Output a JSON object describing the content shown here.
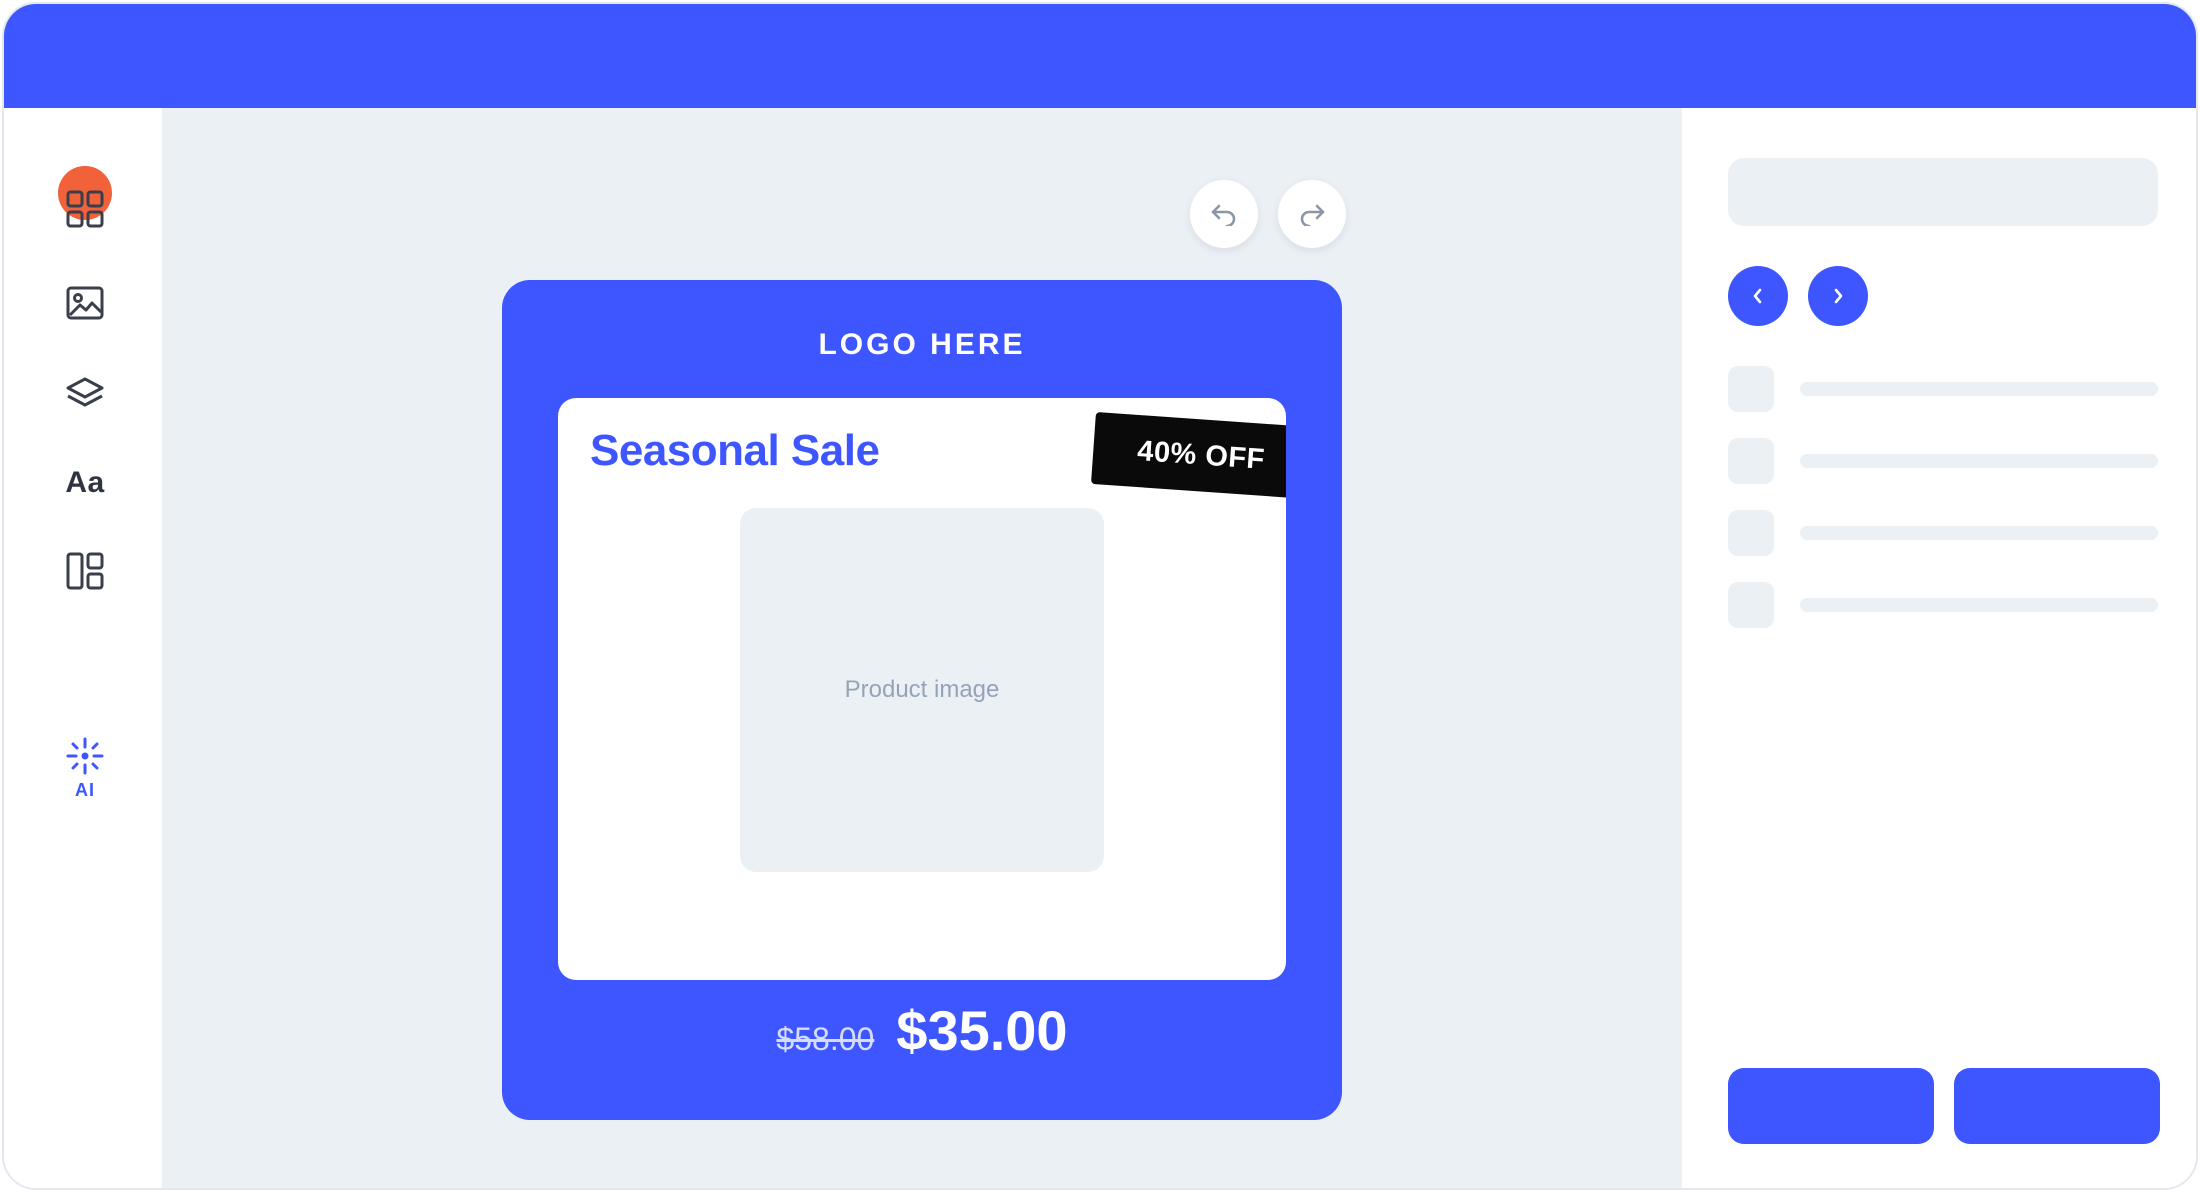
{
  "colors": {
    "brand": "#3d56ff",
    "avatar": "#f1623b",
    "canvas_bg": "#ebf0f5",
    "badge_bg": "#0a0a0a"
  },
  "sidebar": {
    "items": [
      {
        "name": "templates",
        "icon": "grid-icon"
      },
      {
        "name": "images",
        "icon": "image-icon"
      },
      {
        "name": "layers",
        "icon": "layers-icon"
      },
      {
        "name": "text",
        "icon": "text-icon",
        "label": "Aa"
      },
      {
        "name": "layouts",
        "icon": "layout-icon"
      },
      {
        "name": "ai",
        "icon": "sparkle-icon",
        "label": "AI"
      }
    ]
  },
  "toolbar": {
    "undo_icon": "undo-icon",
    "redo_icon": "redo-icon"
  },
  "card": {
    "logo": "LOGO HERE",
    "title": "Seasonal Sale",
    "badge": "40% OFF",
    "image_placeholder": "Product image",
    "old_price": "$58.00",
    "new_price": "$35.00"
  },
  "right_panel": {
    "search_value": "",
    "prev_icon": "chevron-left-icon",
    "next_icon": "chevron-right-icon",
    "list_item_count": 4,
    "primary_button_label": "",
    "secondary_button_label": ""
  }
}
